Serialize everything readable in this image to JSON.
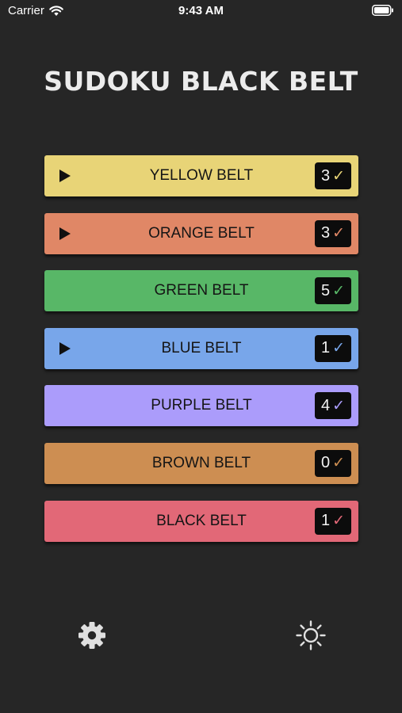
{
  "status_bar": {
    "carrier": "Carrier",
    "time": "9:43 AM",
    "icons": [
      "wifi-icon",
      "battery-icon"
    ]
  },
  "title": "SUDOKU BLACK BELT",
  "belts": [
    {
      "label": "YELLOW BELT",
      "count": "3",
      "check": "✓",
      "color": "#e8d477",
      "check_color": "#e8d477",
      "has_play": true
    },
    {
      "label": "ORANGE BELT",
      "count": "3",
      "check": "✓",
      "color": "#e08766",
      "check_color": "#e08766",
      "has_play": true
    },
    {
      "label": "GREEN BELT",
      "count": "5",
      "check": "✓",
      "color": "#58b767",
      "check_color": "#58b767",
      "has_play": false
    },
    {
      "label": "BLUE BELT",
      "count": "1",
      "check": "✓",
      "color": "#78a6ea",
      "check_color": "#78a6ea",
      "has_play": true
    },
    {
      "label": "PURPLE BELT",
      "count": "4",
      "check": "✓",
      "color": "#ab9cfb",
      "check_color": "#ab9cfb",
      "has_play": false
    },
    {
      "label": "BROWN BELT",
      "count": "0",
      "check": "✓",
      "color": "#cd8e52",
      "check_color": "#cd8e52",
      "has_play": false
    },
    {
      "label": "BLACK BELT",
      "count": "1",
      "check": "✓",
      "color": "#e26877",
      "check_color": "#e26877",
      "has_play": false
    }
  ],
  "bottom_bar": {
    "left_icon": "gear-icon",
    "right_icon": "sun-icon"
  }
}
